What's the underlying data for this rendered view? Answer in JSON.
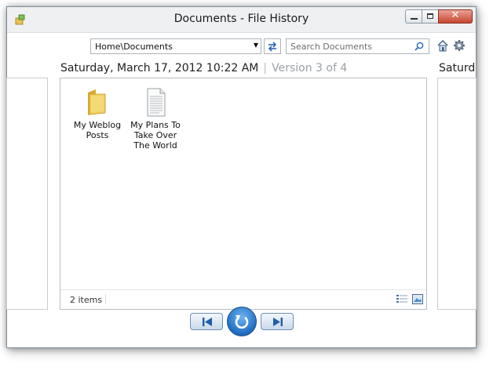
{
  "window": {
    "title": "Documents - File History"
  },
  "toolbar": {
    "address": "Home\\Documents",
    "search_placeholder": "Search Documents"
  },
  "version_header": {
    "date": "Saturday, March 17, 2012 10:22 AM",
    "separator": "|",
    "version": "Version 3 of 4",
    "next_date_partial": "Saturd"
  },
  "items": [
    {
      "label": "My Weblog Posts",
      "icon": "folder-icon"
    },
    {
      "label": "My Plans To Take Over The World",
      "icon": "document-icon"
    }
  ],
  "status": {
    "count": "2 items"
  },
  "colors": {
    "accent": "#1f6dc2",
    "folder": "#f2cf5b",
    "close": "#c7452f"
  }
}
